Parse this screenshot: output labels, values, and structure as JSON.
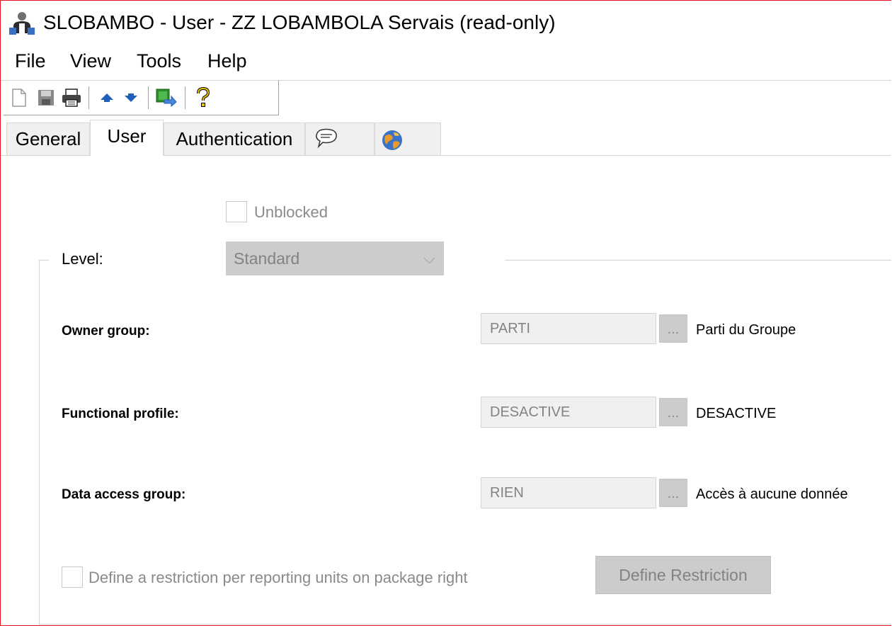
{
  "window": {
    "title": "SLOBAMBO - User - ZZ LOBAMBOLA Servais (read-only)",
    "border_color": "#e81123"
  },
  "menu": [
    "File",
    "View",
    "Tools",
    "Help"
  ],
  "toolbar": {
    "buttons": [
      "new-document-icon",
      "save-icon",
      "print-icon",
      "previous-arrow-icon",
      "next-arrow-icon",
      "export-icon",
      "help-icon"
    ]
  },
  "tabs": {
    "general": "General",
    "user": "User",
    "authentication": "Authentication",
    "comments_icon": "speech-bubble-icon",
    "globe_icon": "globe-icon",
    "active": "User"
  },
  "form": {
    "unblocked_label": "Unblocked",
    "unblocked_checked": false,
    "level_label": "Level:",
    "level_value": "Standard",
    "owner_group_label": "Owner group:",
    "owner_group_value": "PARTI",
    "owner_group_desc": "Parti du Groupe",
    "functional_profile_label": "Functional profile:",
    "functional_profile_value": "DESACTIVE",
    "functional_profile_desc": "DESACTIVE",
    "data_access_group_label": "Data access group:",
    "data_access_group_value": "RIEN",
    "data_access_group_desc": "Accès à aucune donnée",
    "ellipsis_label": "...",
    "restriction_label": "Define a restriction per reporting units on package right",
    "restriction_checked": false,
    "define_restriction_button": "Define Restriction"
  }
}
